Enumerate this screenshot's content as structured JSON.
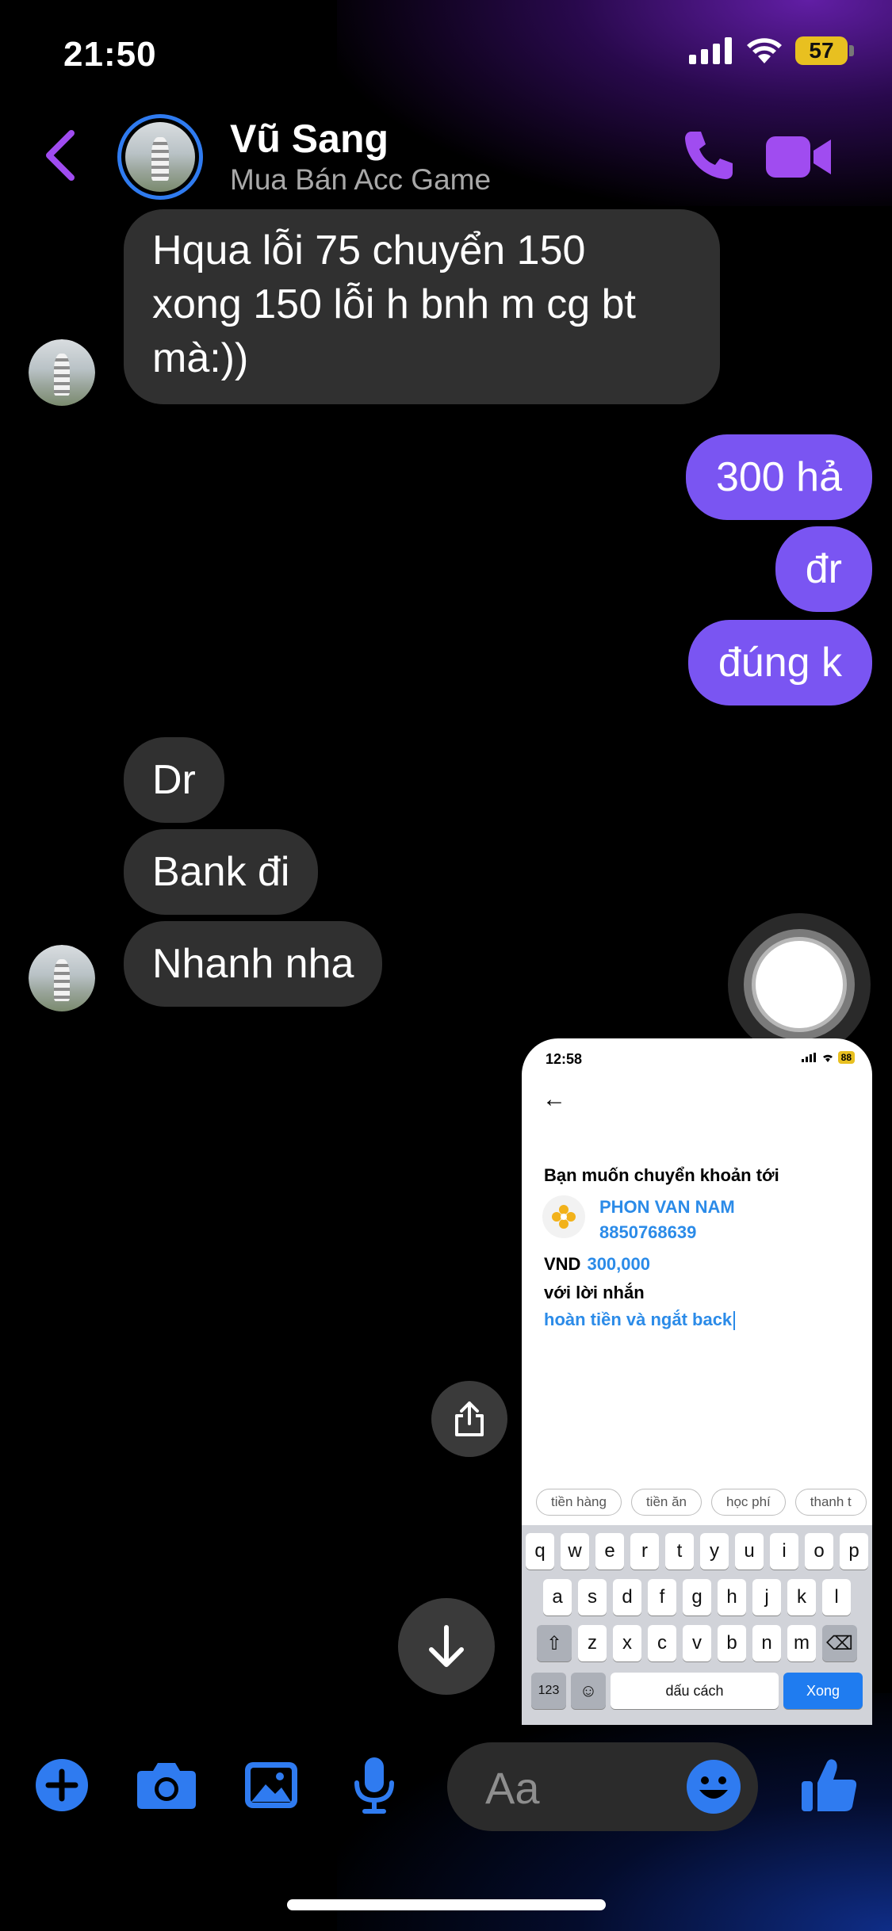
{
  "status_bar": {
    "time": "21:50",
    "battery": "57"
  },
  "header": {
    "name": "Vũ Sang",
    "subtitle": "Mua Bán Acc Game"
  },
  "messages": [
    {
      "side": "received",
      "text_lines": [
        "Hqua lỗi 75 chuyển 150",
        "xong 150 lỗi h bnh m cg bt",
        "mà:))"
      ]
    },
    {
      "side": "sent",
      "text": "300 hả"
    },
    {
      "side": "sent",
      "text": "đr"
    },
    {
      "side": "sent",
      "text": "đúng k"
    },
    {
      "side": "received",
      "text": "Dr"
    },
    {
      "side": "received",
      "text": "Bank đi"
    },
    {
      "side": "received",
      "text": "Nhanh nha"
    }
  ],
  "shared_screenshot": {
    "time": "12:58",
    "battery": "88",
    "title": "Bạn muốn chuyển khoản tới",
    "recipient_name": "PHON VAN NAM",
    "account_number": "8850768639",
    "currency": "VND",
    "amount": "300,000",
    "message_label": "với lời nhắn",
    "message_text": "hoàn tiền và ngắt back",
    "chips": [
      "tiền hàng",
      "tiền ăn",
      "học phí",
      "thanh t"
    ],
    "keyboard": {
      "row1": [
        "q",
        "w",
        "e",
        "r",
        "t",
        "y",
        "u",
        "i",
        "o",
        "p"
      ],
      "row2": [
        "a",
        "s",
        "d",
        "f",
        "g",
        "h",
        "j",
        "k",
        "l"
      ],
      "row3": [
        "z",
        "x",
        "c",
        "v",
        "b",
        "n",
        "m"
      ],
      "numbers_key": "123",
      "space_key": "dấu cách",
      "done_key": "Xong"
    }
  },
  "composer": {
    "placeholder": "Aa"
  },
  "colors": {
    "sent_bubble": "#7a55f2",
    "received_bubble": "#303030",
    "accent_purple": "#a04cf0",
    "accent_blue": "#2f7bf0"
  }
}
